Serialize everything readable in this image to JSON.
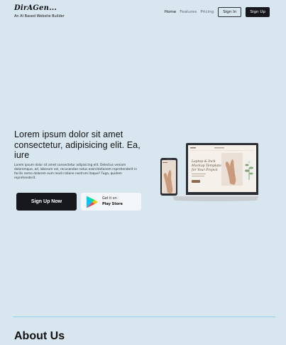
{
  "brand": {
    "name": "DirAGen...",
    "tagline": "An AI Based Website Builder"
  },
  "nav": {
    "links": [
      "Home",
      "Features",
      "Pricing"
    ],
    "sign_in": "Sign In",
    "sign_up": "Sign Up"
  },
  "hero": {
    "title": "Lorem ipsum dolor sit amet consectetur, adipisicing elit. Ea, iure",
    "body": "Lorem ipsum dolor sit amet consectetur adipisicing elit. Delectus veniam doloremque, ad, laborum vel, recusandae natus exercitationem reprehenderit in facilis nemo dolorem eum modi ratione nostrum itaque? Fuga, quidem reprehenderit.",
    "cta_label": "Sign Up Now",
    "store_small": "Get it on",
    "store_big": "Play Store"
  },
  "mockup_screen": {
    "headline": "Laptop & Inch Mockup Template for Your Project"
  },
  "about": {
    "title": "About Us"
  },
  "colors": {
    "background": "#d8e6ef",
    "primary": "#16181d",
    "divider": "#8ed0e4"
  }
}
